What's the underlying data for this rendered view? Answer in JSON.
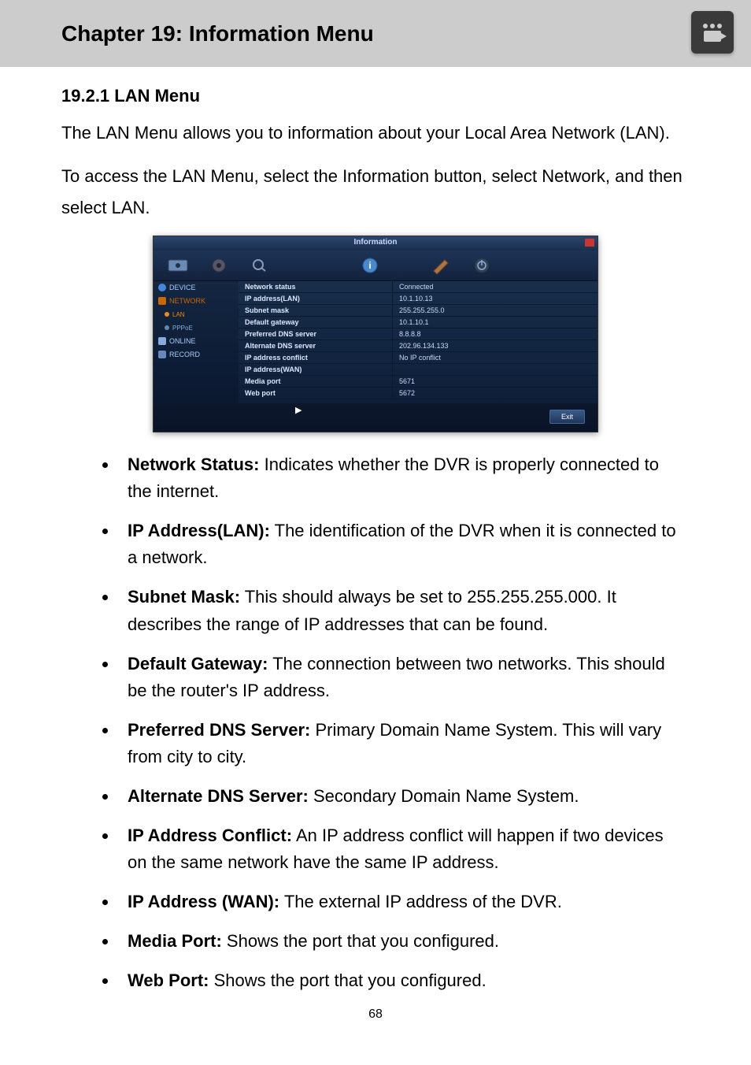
{
  "header": {
    "chapter_title": "Chapter 19: Information Menu"
  },
  "section": {
    "title": "19.2.1 LAN Menu",
    "intro1": "The LAN Menu allows you to information about your Local Area Network (LAN).",
    "intro2": "To access the LAN Menu, select the Information button, select Network, and then select LAN."
  },
  "screenshot": {
    "title": "Information",
    "sidebar": [
      "DEVICE",
      "NETWORK",
      "LAN",
      "PPPoE",
      "ONLINE",
      "RECORD"
    ],
    "rows": [
      {
        "label": "Network status",
        "value": "Connected"
      },
      {
        "label": "IP address(LAN)",
        "value": "10.1.10.13"
      },
      {
        "label": "Subnet mask",
        "value": "255.255.255.0"
      },
      {
        "label": "Default gateway",
        "value": "10.1.10.1"
      },
      {
        "label": "Preferred DNS server",
        "value": "8.8.8.8"
      },
      {
        "label": "Alternate DNS server",
        "value": "202.96.134.133"
      },
      {
        "label": "IP address conflict",
        "value": "No IP conflict"
      },
      {
        "label": "IP address(WAN)",
        "value": ""
      },
      {
        "label": "Media port",
        "value": "5671"
      },
      {
        "label": "Web port",
        "value": "5672"
      }
    ],
    "exit": "Exit"
  },
  "bullets": [
    {
      "term": "Network Status:",
      "desc": " Indicates whether the DVR is properly connected to the internet."
    },
    {
      "term": "IP Address(LAN):",
      "desc": " The identification of the DVR when it is connected to a network."
    },
    {
      "term": "Subnet Mask:",
      "desc": " This should always be set to 255.255.255.000. It describes the range of IP addresses that can be found."
    },
    {
      "term": "Default Gateway:",
      "desc": " The connection between two networks. This should be the router's IP address."
    },
    {
      "term": "Preferred DNS Server:",
      "desc": " Primary Domain Name System. This will vary from city to city."
    },
    {
      "term": "Alternate DNS Server:",
      "desc": " Secondary Domain Name System."
    },
    {
      "term": "IP Address Conflict:",
      "desc": " An IP address conflict will happen if two devices on the same network have the same IP address."
    },
    {
      "term": "IP Address (WAN):",
      "desc": " The external IP address of the DVR."
    },
    {
      "term": "Media Port:",
      "desc": " Shows the port that you configured."
    },
    {
      "term": "Web Port:",
      "desc": " Shows the port that you configured."
    }
  ],
  "page_number": "68"
}
